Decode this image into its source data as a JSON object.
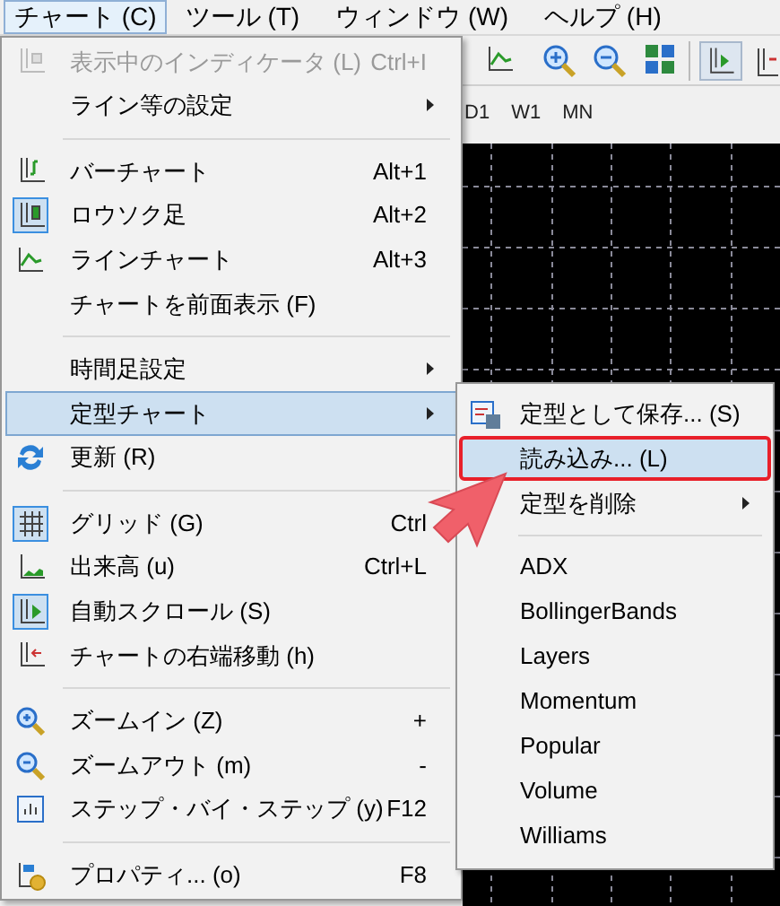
{
  "menubar": [
    {
      "label": "チャート (C)",
      "selected": true
    },
    {
      "label": "ツール (T)",
      "selected": false
    },
    {
      "label": "ウィンドウ (W)",
      "selected": false
    },
    {
      "label": "ヘルプ (H)",
      "selected": false
    }
  ],
  "timeframes": [
    "D1",
    "W1",
    "MN"
  ],
  "chart_menu": [
    {
      "kind": "item",
      "label": "表示中のインディケータ (L)",
      "shortcut": "Ctrl+I",
      "disabled": true,
      "checked": false,
      "selected": false,
      "submenu": false
    },
    {
      "kind": "item",
      "label": "ライン等の設定",
      "disabled": false,
      "selected": false,
      "submenu": true
    },
    {
      "kind": "separator"
    },
    {
      "kind": "item",
      "label": "バーチャート",
      "shortcut": "Alt+1",
      "disabled": false,
      "checked": false,
      "selected": false,
      "submenu": false
    },
    {
      "kind": "item",
      "label": "ロウソク足",
      "shortcut": "Alt+2",
      "disabled": false,
      "checked": true,
      "selected": false,
      "submenu": false
    },
    {
      "kind": "item",
      "label": "ラインチャート",
      "shortcut": "Alt+3",
      "disabled": false,
      "checked": false,
      "selected": false,
      "submenu": false
    },
    {
      "kind": "item",
      "label": "チャートを前面表示 (F)",
      "disabled": false,
      "selected": false,
      "submenu": false
    },
    {
      "kind": "separator"
    },
    {
      "kind": "item",
      "label": "時間足設定",
      "disabled": false,
      "selected": false,
      "submenu": true
    },
    {
      "kind": "item",
      "label": "定型チャート",
      "disabled": false,
      "selected": true,
      "submenu": true
    },
    {
      "kind": "item",
      "label": "更新 (R)",
      "disabled": false,
      "checked": false,
      "selected": false,
      "submenu": false
    },
    {
      "kind": "separator"
    },
    {
      "kind": "item",
      "label": "グリッド (G)",
      "shortcut": "Ctrl",
      "disabled": false,
      "checked": true,
      "selected": false,
      "submenu": false
    },
    {
      "kind": "item",
      "label": "出来高 (u)",
      "shortcut": "Ctrl+L",
      "disabled": false,
      "checked": false,
      "selected": false,
      "submenu": false
    },
    {
      "kind": "item",
      "label": "自動スクロール (S)",
      "disabled": false,
      "checked": true,
      "selected": false,
      "submenu": false
    },
    {
      "kind": "item",
      "label": "チャートの右端移動 (h)",
      "disabled": false,
      "checked": false,
      "selected": false,
      "submenu": false
    },
    {
      "kind": "separator"
    },
    {
      "kind": "item",
      "label": "ズームイン (Z)",
      "shortcut": "+",
      "disabled": false,
      "checked": false,
      "selected": false,
      "submenu": false
    },
    {
      "kind": "item",
      "label": "ズームアウト (m)",
      "shortcut": "-",
      "disabled": false,
      "checked": false,
      "selected": false,
      "submenu": false
    },
    {
      "kind": "item",
      "label": "ステップ・バイ・ステップ (y)",
      "shortcut": "F12",
      "disabled": false,
      "checked": false,
      "selected": false,
      "submenu": false
    },
    {
      "kind": "separator"
    },
    {
      "kind": "item",
      "label": "プロパティ... (o)",
      "shortcut": "F8",
      "disabled": false,
      "checked": false,
      "selected": false,
      "submenu": false
    }
  ],
  "template_submenu": [
    {
      "kind": "item",
      "label": "定型として保存... (S)",
      "selected": false,
      "highlighted": false,
      "submenu": false
    },
    {
      "kind": "item",
      "label": "読み込み... (L)",
      "selected": true,
      "highlighted": true,
      "submenu": false
    },
    {
      "kind": "item",
      "label": "定型を削除",
      "selected": false,
      "highlighted": false,
      "submenu": true
    },
    {
      "kind": "separator"
    },
    {
      "kind": "item",
      "label": "ADX",
      "selected": false,
      "highlighted": false,
      "submenu": false
    },
    {
      "kind": "item",
      "label": "BollingerBands",
      "selected": false,
      "highlighted": false,
      "submenu": false
    },
    {
      "kind": "item",
      "label": "Layers",
      "selected": false,
      "highlighted": false,
      "submenu": false
    },
    {
      "kind": "item",
      "label": "Momentum",
      "selected": false,
      "highlighted": false,
      "submenu": false
    },
    {
      "kind": "item",
      "label": "Popular",
      "selected": false,
      "highlighted": false,
      "submenu": false
    },
    {
      "kind": "item",
      "label": "Volume",
      "selected": false,
      "highlighted": false,
      "submenu": false
    },
    {
      "kind": "item",
      "label": "Williams",
      "selected": false,
      "highlighted": false,
      "submenu": false
    }
  ]
}
